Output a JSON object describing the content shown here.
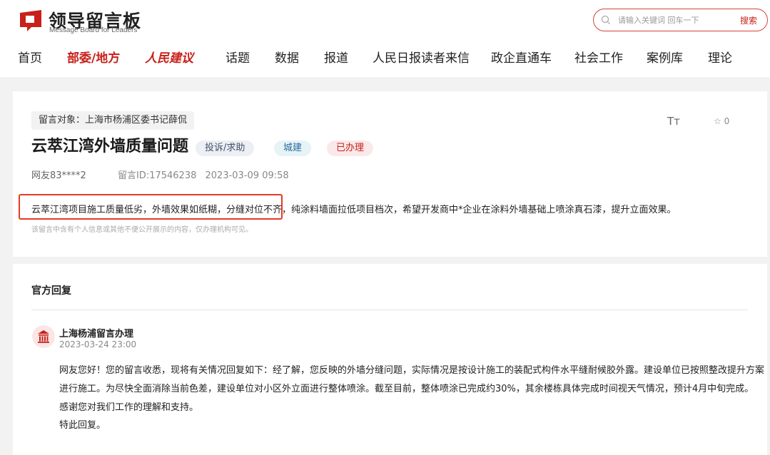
{
  "brand": {
    "name_cn": "领导留言板",
    "name_en": "Message Board for Leaders",
    "accent_color": "#c8201a"
  },
  "search": {
    "placeholder": "请输入关键词 回车一下",
    "button_label": "搜索"
  },
  "nav": {
    "items": [
      {
        "label": "首页"
      },
      {
        "label": "部委/地方"
      },
      {
        "label": "人民建议"
      },
      {
        "label": "话题"
      },
      {
        "label": "数据"
      },
      {
        "label": "报道"
      },
      {
        "label": "人民日报读者来信"
      },
      {
        "label": "政企直通车"
      },
      {
        "label": "社会工作"
      },
      {
        "label": "案例库"
      },
      {
        "label": "理论"
      }
    ],
    "active": "部委/地方"
  },
  "message": {
    "target": "留言对象：上海市杨浦区委书记薛侃",
    "font_toggle": "Tт",
    "favorite_count": "☆ 0",
    "title": "云萃江湾外墙质量问题",
    "tags": {
      "type": "投诉/求助",
      "category": "城建",
      "status": "已办理"
    },
    "user": "网友83****2",
    "id_label": "留言ID:17546238",
    "datetime": "2023-03-09 09:58",
    "body": "云萃江湾项目施工质量低劣，外墙效果如纸糊，分缝对位不齐，纯涂料墙面拉低项目档次，希望开发商中*企业在涂料外墙基础上喷涂真石漆，提升立面效果。",
    "privacy_notice": "该留言中含有个人信息或其他不便公开展示的内容，仅办理机构可见。"
  },
  "reply": {
    "heading": "官方回复",
    "org_name": "上海杨浦留言办理",
    "time": "2023-03-24 23:00",
    "lines": [
      "网友您好！您的留言收悉，现将有关情况回复如下：经了解，您反映的外墙分缝问题，实际情况是按设计施工的装配式构件水平缝耐候胶外露。建设单位已按照整改提升方案",
      "进行施工。为尽快全面消除当前色差，建设单位对小区外立面进行整体喷涂。截至目前，整体喷涂已完成约30%，其余楼栋具体完成时间视天气情况，预计4月中旬完成。",
      "感谢您对我们工作的理解和支持。",
      "特此回复。"
    ]
  }
}
